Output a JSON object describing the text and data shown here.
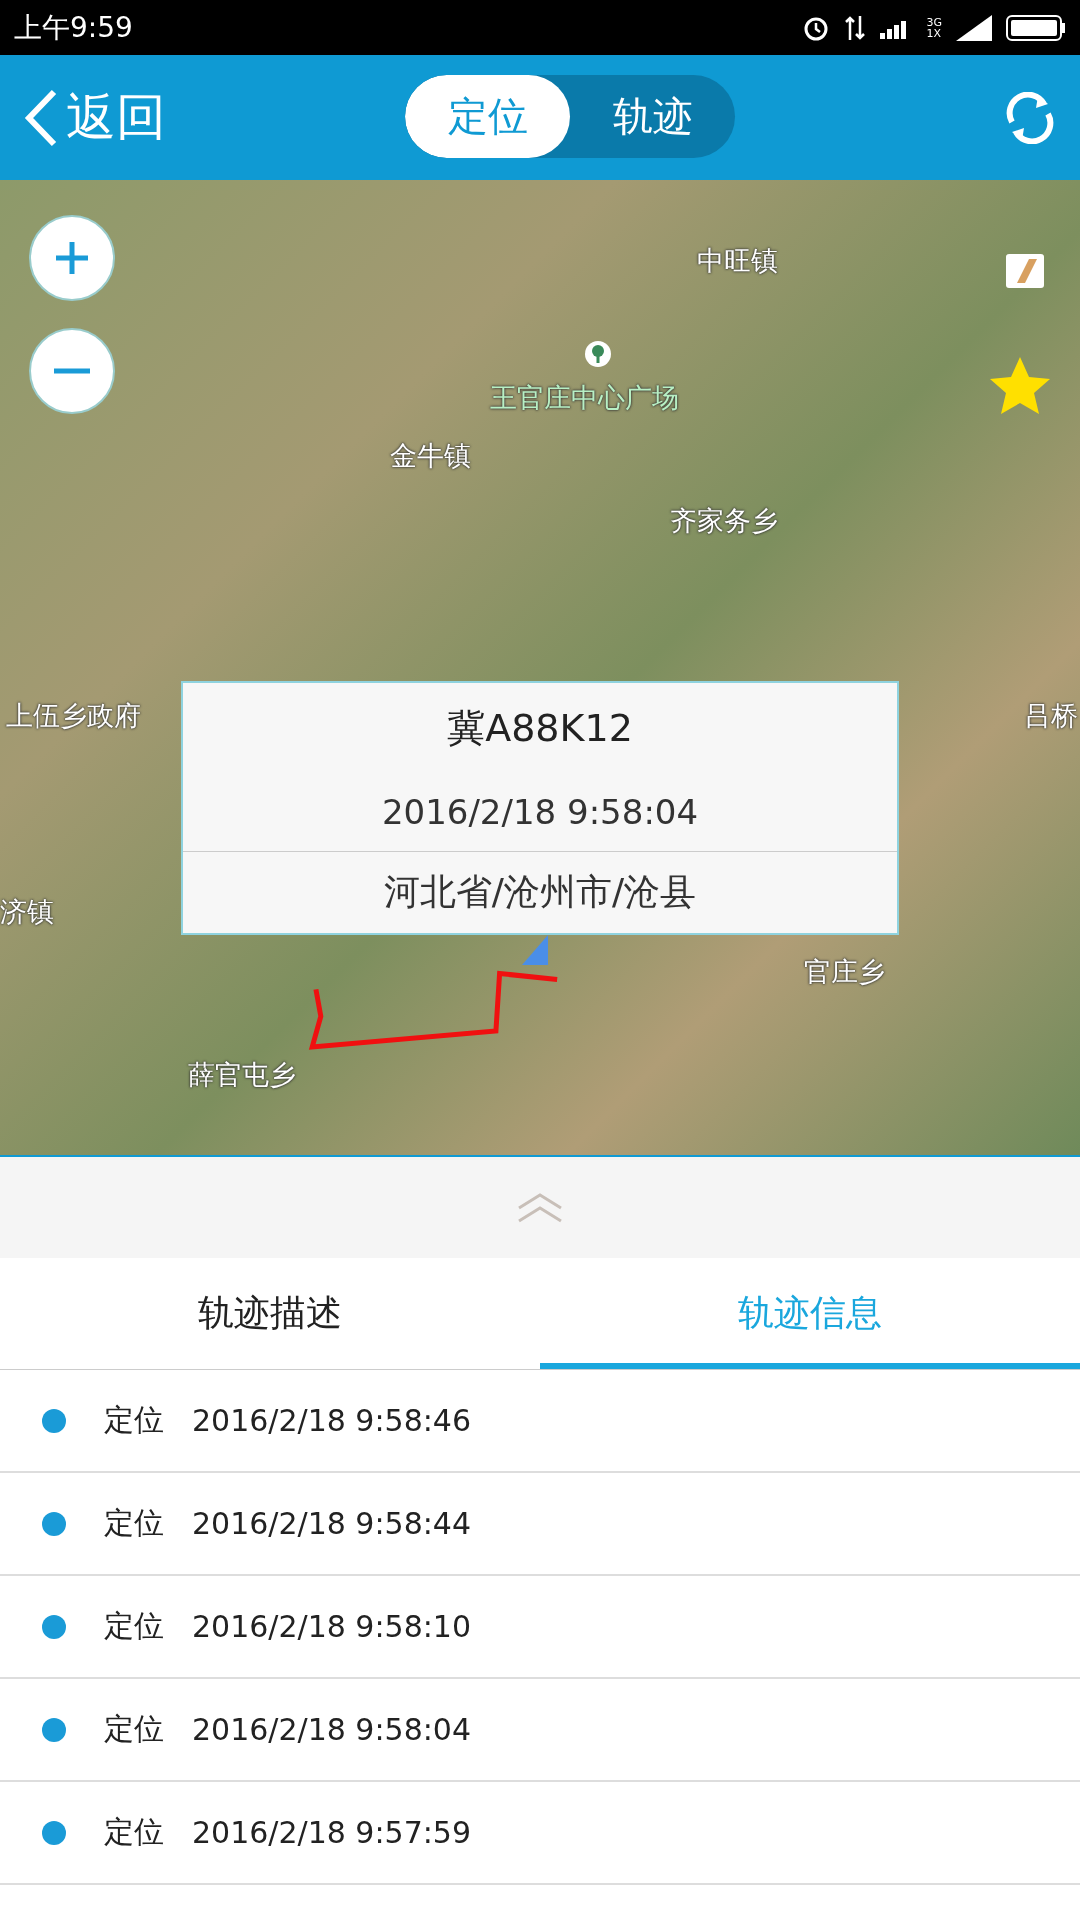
{
  "status_bar": {
    "time": "上午9:59",
    "network": [
      "3G",
      "1X"
    ]
  },
  "header": {
    "back_label": "返回",
    "tabs": [
      {
        "label": "定位",
        "selected": true
      },
      {
        "label": "轨迹",
        "selected": false
      }
    ]
  },
  "map": {
    "labels": [
      {
        "text": "中旺镇",
        "kind": "town"
      },
      {
        "text": "王官庄中心广场",
        "kind": "poi"
      },
      {
        "text": "金牛镇",
        "kind": "town"
      },
      {
        "text": "齐家务乡",
        "kind": "town"
      },
      {
        "text": "上伍乡政府",
        "kind": "town"
      },
      {
        "text": "吕桥",
        "kind": "town"
      },
      {
        "text": "济镇",
        "kind": "town"
      },
      {
        "text": "官庄乡",
        "kind": "town"
      },
      {
        "text": "薛官屯乡",
        "kind": "town"
      }
    ],
    "popup": {
      "plate": "冀A88K12",
      "time": "2016/2/18 9:58:04",
      "address": "河北省/沧州市/沧县"
    }
  },
  "panel": {
    "tabs": [
      {
        "label": "轨迹描述",
        "selected": false
      },
      {
        "label": "轨迹信息",
        "selected": true
      }
    ],
    "records": [
      {
        "type": "定位",
        "time": "2016/2/18 9:58:46",
        "color": "#1a9bd7"
      },
      {
        "type": "定位",
        "time": "2016/2/18 9:58:44",
        "color": "#1a9bd7"
      },
      {
        "type": "定位",
        "time": "2016/2/18 9:58:10",
        "color": "#1a9bd7"
      },
      {
        "type": "定位",
        "time": "2016/2/18 9:58:04",
        "color": "#1a9bd7"
      },
      {
        "type": "定位",
        "time": "2016/2/18 9:57:59",
        "color": "#1a9bd7"
      }
    ]
  }
}
